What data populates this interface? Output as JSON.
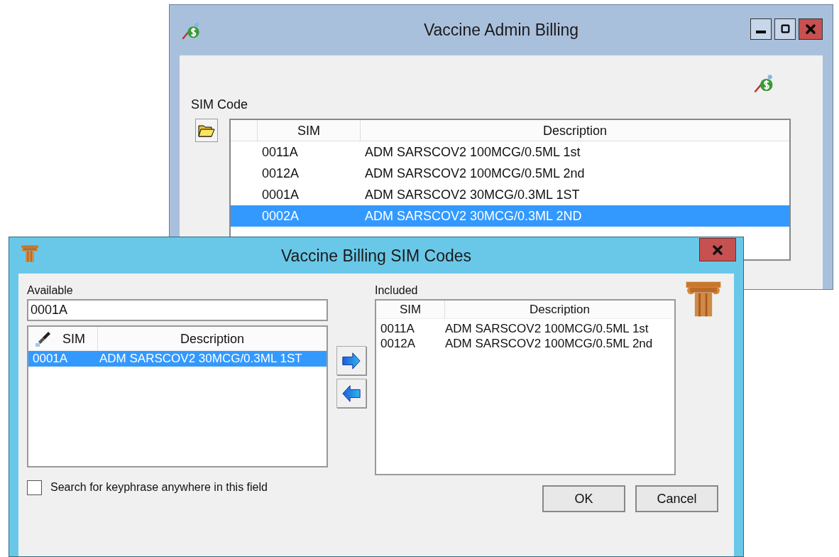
{
  "back_window": {
    "title": "Vaccine Admin Billing",
    "section_label": "SIM Code",
    "table": {
      "columns": [
        "SIM",
        "Description"
      ],
      "rows": [
        {
          "sim": "0011A",
          "description": "ADM SARSCOV2 100MCG/0.5ML 1st",
          "selected": false
        },
        {
          "sim": "0012A",
          "description": "ADM SARSCOV2 100MCG/0.5ML 2nd",
          "selected": false
        },
        {
          "sim": "0001A",
          "description": "ADM SARSCOV2 30MCG/0.3ML 1ST",
          "selected": false
        },
        {
          "sim": "0002A",
          "description": "ADM SARSCOV2 30MCG/0.3ML 2ND",
          "selected": true
        }
      ]
    }
  },
  "dialog": {
    "title": "Vaccine Billing SIM Codes",
    "available": {
      "label": "Available",
      "value": "0001A",
      "columns": [
        "SIM",
        "Description"
      ],
      "rows": [
        {
          "sim": "0001A",
          "description": "ADM SARSCOV2 30MCG/0.3ML 1ST",
          "selected": true
        }
      ]
    },
    "included": {
      "label": "Included",
      "columns": [
        "SIM",
        "Description"
      ],
      "rows": [
        {
          "sim": "0011A",
          "description": "ADM SARSCOV2 100MCG/0.5ML 1st"
        },
        {
          "sim": "0012A",
          "description": "ADM SARSCOV2 100MCG/0.5ML 2nd"
        }
      ]
    },
    "search_anywhere": {
      "label": "Search for keyphrase anywhere in this field",
      "checked": false
    },
    "buttons": [
      "OK",
      "Cancel"
    ]
  }
}
